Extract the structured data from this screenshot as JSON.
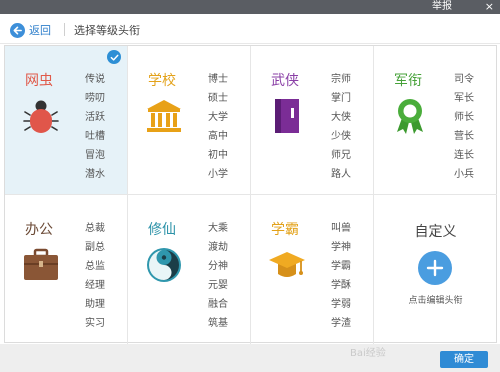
{
  "titlebar": {
    "report_label": "举报",
    "close_label": "×"
  },
  "header": {
    "back_label": "返回",
    "breadcrumb": "选择等级头衔"
  },
  "categories": [
    {
      "name": "网虫",
      "color": "#e05a4a",
      "icon": "bug-icon",
      "selected": true,
      "titles": [
        "传说",
        "唠叨",
        "活跃",
        "吐槽",
        "冒泡",
        "潜水"
      ]
    },
    {
      "name": "学校",
      "color": "#e3a21a",
      "icon": "school-building-icon",
      "selected": false,
      "titles": [
        "博士",
        "硕士",
        "大学",
        "高中",
        "初中",
        "小学"
      ]
    },
    {
      "name": "武侠",
      "color": "#8a3fa6",
      "icon": "book-icon",
      "selected": false,
      "titles": [
        "宗师",
        "掌门",
        "大侠",
        "少侠",
        "师兄",
        "路人"
      ]
    },
    {
      "name": "军衔",
      "color": "#47a23a",
      "icon": "medal-icon",
      "selected": false,
      "titles": [
        "司令",
        "军长",
        "师长",
        "营长",
        "连长",
        "小兵"
      ]
    },
    {
      "name": "办公",
      "color": "#8b5a3c",
      "icon": "briefcase-icon",
      "selected": false,
      "titles": [
        "总裁",
        "副总",
        "总监",
        "经理",
        "助理",
        "实习"
      ]
    },
    {
      "name": "修仙",
      "color": "#2c92a8",
      "icon": "yin-yang-icon",
      "selected": false,
      "titles": [
        "大乘",
        "渡劫",
        "分神",
        "元婴",
        "融合",
        "筑基"
      ]
    },
    {
      "name": "学霸",
      "color": "#e3a21a",
      "icon": "graduation-cap-icon",
      "selected": false,
      "titles": [
        "叫兽",
        "学神",
        "学霸",
        "学酥",
        "学弱",
        "学渣"
      ]
    }
  ],
  "custom": {
    "label": "自定义",
    "hint": "点击编辑头衔",
    "icon": "plus-icon"
  },
  "footer": {
    "ok_label": "确定",
    "watermark": "Bai经验"
  }
}
